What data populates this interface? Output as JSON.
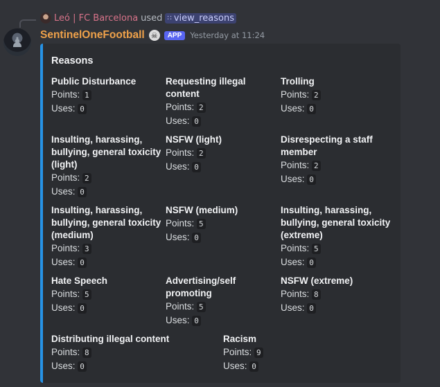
{
  "reply": {
    "user": "Leó | FC Barcelona",
    "used": "used",
    "command": "view_reasons"
  },
  "message": {
    "username": "SentinelOneFootball",
    "badge": "APP",
    "timestamp": "Yesterday at 11:24"
  },
  "embed": {
    "title": "Reasons",
    "accent_color": "#2693e6",
    "points_label": "Points:",
    "uses_label": "Uses:",
    "fields": [
      {
        "name": "Public Disturbance",
        "points": "1",
        "uses": "0"
      },
      {
        "name": "Requesting illegal content",
        "points": "2",
        "uses": "0"
      },
      {
        "name": "Trolling",
        "points": "2",
        "uses": "0"
      },
      {
        "name": "Insulting, harassing, bullying, general toxicity (light)",
        "points": "2",
        "uses": "0"
      },
      {
        "name": "NSFW (light)",
        "points": "2",
        "uses": "0"
      },
      {
        "name": "Disrespecting a staff member",
        "points": "2",
        "uses": "0"
      },
      {
        "name": "Insulting, harassing, bullying, general toxicity (medium)",
        "points": "3",
        "uses": "0"
      },
      {
        "name": "NSFW (medium)",
        "points": "5",
        "uses": "0"
      },
      {
        "name": "Insulting, harassing, bullying, general toxicity (extreme)",
        "points": "5",
        "uses": "0"
      },
      {
        "name": "Hate Speech",
        "points": "5",
        "uses": "0"
      },
      {
        "name": "Advertising/self promoting",
        "points": "5",
        "uses": "0"
      },
      {
        "name": "NSFW (extreme)",
        "points": "8",
        "uses": "0"
      },
      {
        "name": "Distributing illegal content",
        "points": "8",
        "uses": "0"
      },
      {
        "name": "Racism",
        "points": "9",
        "uses": "0"
      }
    ]
  }
}
